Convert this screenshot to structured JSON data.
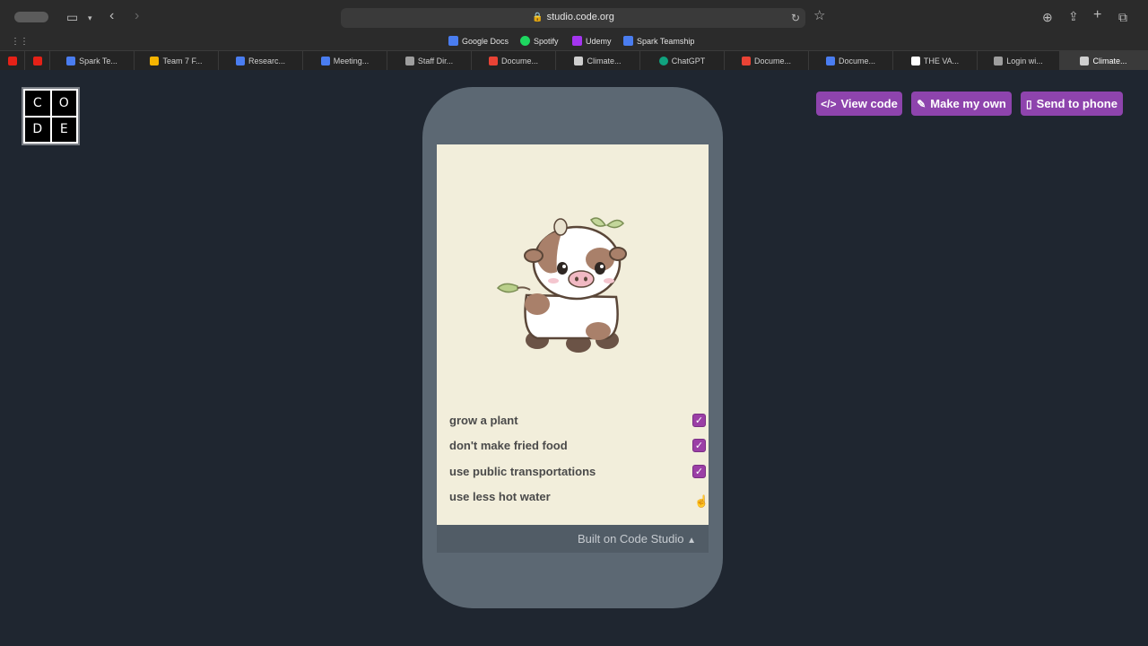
{
  "browser": {
    "url": "studio.code.org",
    "bookmarks": [
      {
        "label": "Google Docs",
        "color": "#4a7df0"
      },
      {
        "label": "Spotify",
        "color": "#1ed760"
      },
      {
        "label": "Udemy",
        "color": "#a435f0"
      },
      {
        "label": "Spark Teamship",
        "color": "#4a7df0"
      }
    ],
    "tabs": [
      {
        "label": "Spark Te...",
        "color": "#4a7df0"
      },
      {
        "label": "Team 7 F...",
        "color": "#f5b400"
      },
      {
        "label": "Researc...",
        "color": "#4a7df0"
      },
      {
        "label": "Meeting...",
        "color": "#4a7df0"
      },
      {
        "label": "Staff Dir...",
        "color": "#9e9e9e"
      },
      {
        "label": "Docume...",
        "color": "#ea4335"
      },
      {
        "label": "Climate...",
        "color": "#cfcfcf"
      },
      {
        "label": "ChatGPT",
        "color": "#10a37f"
      },
      {
        "label": "Docume...",
        "color": "#ea4335"
      },
      {
        "label": "Docume...",
        "color": "#4a7df0"
      },
      {
        "label": "THE VA...",
        "color": "#ffffff"
      },
      {
        "label": "Login wi...",
        "color": "#9e9e9e"
      },
      {
        "label": "Climate...",
        "color": "#cfcfcf"
      }
    ]
  },
  "logo": {
    "letters": [
      "C",
      "O",
      "D",
      "E"
    ]
  },
  "actions": {
    "view_code": "View code",
    "make_my_own": "Make my own",
    "send_to_phone": "Send to phone"
  },
  "app": {
    "tasks": [
      {
        "label": "grow a plant",
        "checked": true
      },
      {
        "label": "don't make fried food",
        "checked": true
      },
      {
        "label": "use public transportations",
        "checked": true
      },
      {
        "label": "use less hot water",
        "checked": false
      }
    ],
    "footer": "Built on Code Studio"
  },
  "colors": {
    "accent": "#8e44ad",
    "page_bg": "#1f2630",
    "app_bg": "#f2eedb"
  }
}
